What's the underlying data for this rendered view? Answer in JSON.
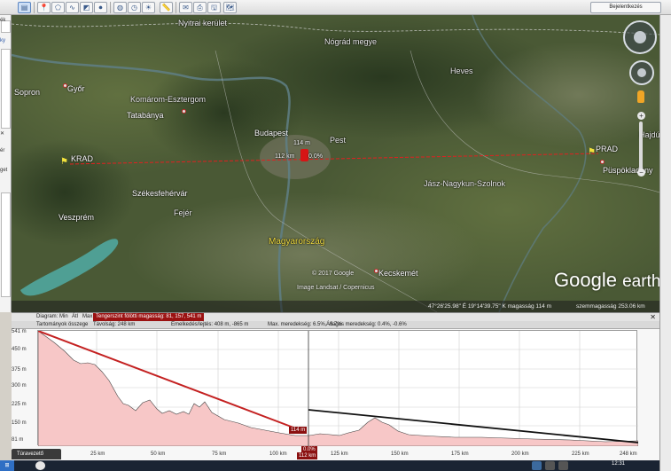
{
  "toolbar": {
    "signin_label": "Bejelentkezés",
    "icons": [
      "sidebar-toggle-icon",
      "placemark-icon",
      "polygon-icon",
      "path-icon",
      "overlay-icon",
      "tour-icon",
      "planets-icon",
      "historical-imagery-icon",
      "sunlight-icon",
      "ruler-icon",
      "email-icon",
      "print-icon",
      "save-image-icon",
      "maps-icon"
    ]
  },
  "sidebar": {
    "fragments": [
      "ék",
      "ér",
      "get",
      "ky"
    ]
  },
  "map": {
    "places": {
      "nyitrai": "Nyitrai kerület",
      "nograd": "Nógrád megye",
      "sopron": "Sopron",
      "gyor": "Győr",
      "heves": "Heves",
      "komarom": "Komárom-Esztergom",
      "tatabanya": "Tatabánya",
      "budapest": "Budapest",
      "pest": "Pest",
      "hajdu": "Hajdú",
      "prad": "PRAD",
      "puspok": "Püspökladány",
      "krad": "KRAD",
      "jasz": "Jász-Nagykun-Szolnok",
      "szekesfehervar": "Székesfehérvár",
      "fejer": "Fejér",
      "veszprem": "Veszprém",
      "magyarorszag": "Magyarország",
      "kecskemet": "Kecskemét"
    },
    "measure": {
      "height": "114 m",
      "distance": "112 km",
      "grade": "0.0%"
    },
    "copyright_line1": "© 2017 Google",
    "copyright_line2": "Image Landsat / Copernicus",
    "logo_main": "Google",
    "logo_sub": "earth"
  },
  "statusbar": {
    "coords": "47°26'25.98\" É   19°14'39.75\" K  magasság   114 m",
    "eye_alt": "szemmagasság  253.06 km"
  },
  "profile": {
    "bar1": {
      "diagram": "Diagram:",
      "min": "Min",
      "avg": "Átl",
      "max": "Max",
      "sea_level": "Tengerszint fölötti magasság:  81,  157,  541 m"
    },
    "bar2": {
      "range_total": "Tartományok összege",
      "distance": "Távolság:  248 km",
      "gain_loss": "Emelkedés/lejtés:  408 m,  -865 m",
      "max_slope": "Max. meredekség:  6.5%,  -6.7%",
      "avg_slope": "Átlagos meredekség:  0.4%,  -0.6%"
    },
    "y_ticks": [
      "541 m",
      "450 m",
      "375 m",
      "300 m",
      "225 m",
      "150 m",
      "81 m"
    ],
    "x_ticks": [
      "25 km",
      "50 km",
      "75 km",
      "100 km",
      "125 km",
      "150 km",
      "175 km",
      "200 km",
      "225 km",
      "248 km"
    ],
    "cursor_x_label": "112 km",
    "cursor_value": "114 m",
    "cursor_grade": "0.0%",
    "fill_color": "#f7c7c7",
    "slope_line_color": "#c42121"
  },
  "tour_label": "Túravezető",
  "taskbar": {
    "time": "12:31"
  }
}
